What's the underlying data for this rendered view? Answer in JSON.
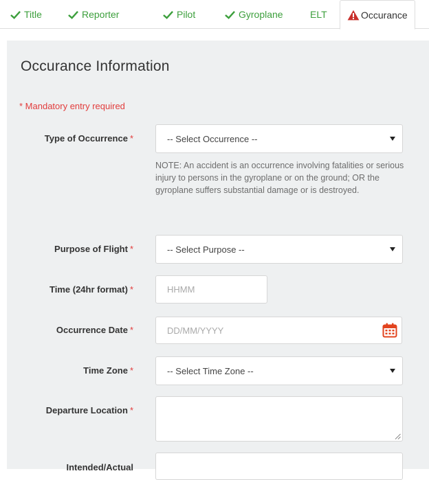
{
  "tabs": [
    {
      "label": "Title",
      "state": "complete"
    },
    {
      "label": "Reporter",
      "state": "complete"
    },
    {
      "label": "Pilot",
      "state": "complete"
    },
    {
      "label": "Gyroplane",
      "state": "complete"
    },
    {
      "label": "ELT",
      "state": "plain"
    },
    {
      "label": "Occurance",
      "state": "active-warning"
    }
  ],
  "colors": {
    "complete": "#3c9f3c",
    "warning": "#c9302c",
    "required": "#e23c3c",
    "panel": "#eef0f1",
    "calendar": "#e2431e"
  },
  "panel": {
    "title": "Occurance Information",
    "mandatory_note": "* Mandatory entry required"
  },
  "fields": {
    "type_of_occurrence": {
      "label": "Type of Occurrence",
      "required_mark": "*",
      "selected": "-- Select Occurrence --",
      "note": "NOTE: An accident is an occurrence involving fatalities or serious injury to persons in the gyroplane or on the ground; OR the gyroplane suffers substantial damage or is destroyed."
    },
    "purpose_of_flight": {
      "label": "Purpose of Flight",
      "required_mark": "*",
      "selected": "-- Select Purpose --"
    },
    "time": {
      "label": "Time (24hr format)",
      "required_mark": "*",
      "placeholder": "HHMM"
    },
    "occurrence_date": {
      "label": "Occurrence Date",
      "required_mark": "*",
      "placeholder": "DD/MM/YYYY",
      "icon": "calendar-icon"
    },
    "time_zone": {
      "label": "Time Zone",
      "required_mark": "*",
      "selected": "-- Select Time Zone --"
    },
    "departure_location": {
      "label": "Departure Location",
      "required_mark": "*",
      "value": ""
    },
    "intended_actual": {
      "label": "Intended/Actual"
    }
  }
}
